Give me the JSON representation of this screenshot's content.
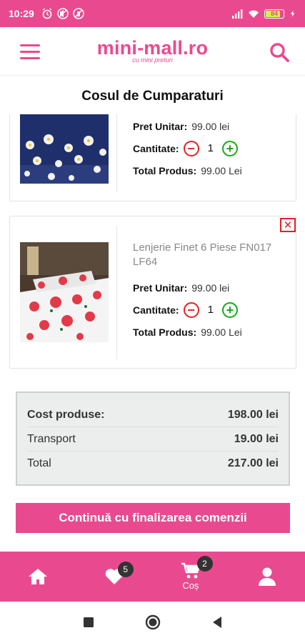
{
  "status_bar": {
    "time": "10:29",
    "battery": "84",
    "icons": [
      "alarm-icon",
      "mute-icon",
      "dnd-icon",
      "signal-icon",
      "wifi-icon",
      "battery-icon",
      "charging-icon"
    ]
  },
  "header": {
    "logo": "mini-mall.ro",
    "tagline": "cu mini preturi"
  },
  "page_title": "Cosul de Cumparaturi",
  "cart_items": [
    {
      "name": "",
      "unit_price_label": "Pret Unitar:",
      "unit_price": "99.00 lei",
      "quantity_label": "Cantitate:",
      "quantity": "1",
      "total_label": "Total Produs:",
      "total": "99.00 Lei"
    },
    {
      "name": "Lenjerie Finet 6 Piese FN017    LF64",
      "unit_price_label": "Pret Unitar:",
      "unit_price": "99.00 lei",
      "quantity_label": "Cantitate:",
      "quantity": "1",
      "total_label": "Total Produs:",
      "total": "99.00 Lei"
    }
  ],
  "summary": {
    "products_label": "Cost produse:",
    "products_value": "198.00 lei",
    "transport_label": "Transport",
    "transport_value": "19.00 lei",
    "total_label": "Total",
    "total_value": "217.00 lei"
  },
  "checkout_label": "Continuă cu finalizarea comenzii",
  "bottom_nav": {
    "wishlist_count": "5",
    "cart_count": "2",
    "cart_label": "Coș"
  },
  "colors": {
    "brand": "#e94a8f",
    "remove": "#e02424",
    "add": "#18a818"
  }
}
